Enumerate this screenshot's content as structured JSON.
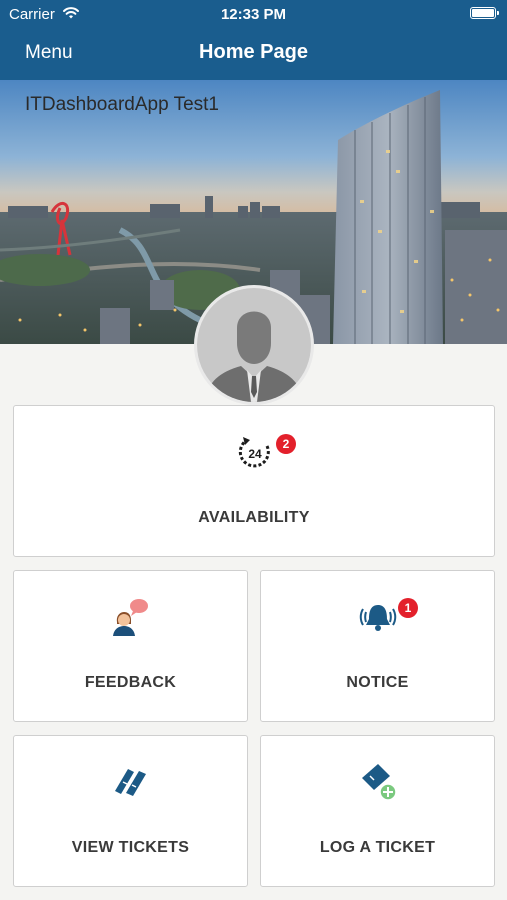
{
  "status_bar": {
    "carrier": "Carrier",
    "time": "12:33 PM"
  },
  "nav": {
    "menu_label": "Menu",
    "title": "Home Page"
  },
  "banner": {
    "app_title": "ITDashboardApp Test1"
  },
  "tiles": {
    "availability": {
      "label": "AVAILABILITY",
      "icon": "24-hours-clock-icon",
      "badge": "2",
      "icon_text": "24"
    },
    "feedback": {
      "label": "FEEDBACK",
      "icon": "person-speech-bubble-icon"
    },
    "notice": {
      "label": "NOTICE",
      "icon": "ringing-bell-icon",
      "badge": "1"
    },
    "view_tickets": {
      "label": "VIEW TICKETS",
      "icon": "tickets-icon"
    },
    "log_ticket": {
      "label": "LOG A TICKET",
      "icon": "ticket-add-icon"
    }
  },
  "colors": {
    "header": "#1a5d8e",
    "badge": "#e3202b",
    "icon_blue": "#1c5a86"
  }
}
